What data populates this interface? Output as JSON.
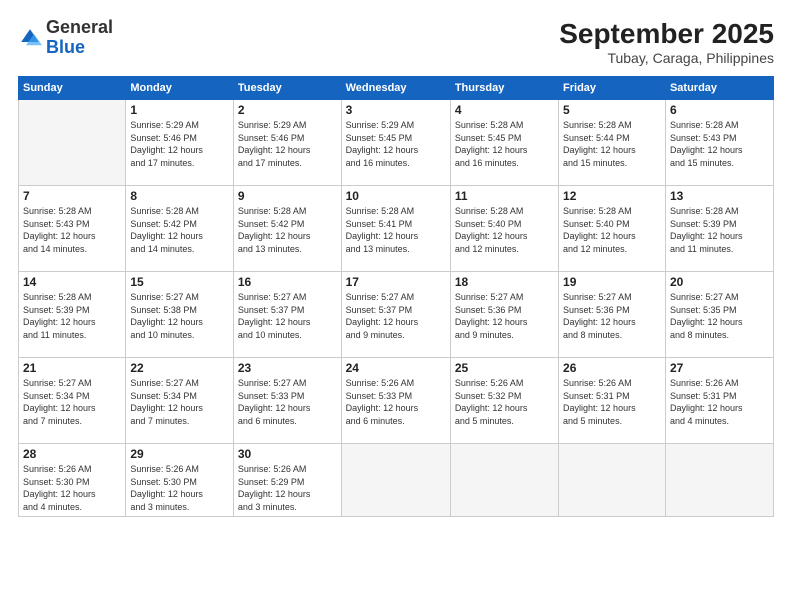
{
  "logo": {
    "general": "General",
    "blue": "Blue"
  },
  "header": {
    "month_year": "September 2025",
    "location": "Tubay, Caraga, Philippines"
  },
  "weekdays": [
    "Sunday",
    "Monday",
    "Tuesday",
    "Wednesday",
    "Thursday",
    "Friday",
    "Saturday"
  ],
  "weeks": [
    [
      {
        "day": "",
        "info": ""
      },
      {
        "day": "1",
        "info": "Sunrise: 5:29 AM\nSunset: 5:46 PM\nDaylight: 12 hours\nand 17 minutes."
      },
      {
        "day": "2",
        "info": "Sunrise: 5:29 AM\nSunset: 5:46 PM\nDaylight: 12 hours\nand 17 minutes."
      },
      {
        "day": "3",
        "info": "Sunrise: 5:29 AM\nSunset: 5:45 PM\nDaylight: 12 hours\nand 16 minutes."
      },
      {
        "day": "4",
        "info": "Sunrise: 5:28 AM\nSunset: 5:45 PM\nDaylight: 12 hours\nand 16 minutes."
      },
      {
        "day": "5",
        "info": "Sunrise: 5:28 AM\nSunset: 5:44 PM\nDaylight: 12 hours\nand 15 minutes."
      },
      {
        "day": "6",
        "info": "Sunrise: 5:28 AM\nSunset: 5:43 PM\nDaylight: 12 hours\nand 15 minutes."
      }
    ],
    [
      {
        "day": "7",
        "info": "Sunrise: 5:28 AM\nSunset: 5:43 PM\nDaylight: 12 hours\nand 14 minutes."
      },
      {
        "day": "8",
        "info": "Sunrise: 5:28 AM\nSunset: 5:42 PM\nDaylight: 12 hours\nand 14 minutes."
      },
      {
        "day": "9",
        "info": "Sunrise: 5:28 AM\nSunset: 5:42 PM\nDaylight: 12 hours\nand 13 minutes."
      },
      {
        "day": "10",
        "info": "Sunrise: 5:28 AM\nSunset: 5:41 PM\nDaylight: 12 hours\nand 13 minutes."
      },
      {
        "day": "11",
        "info": "Sunrise: 5:28 AM\nSunset: 5:40 PM\nDaylight: 12 hours\nand 12 minutes."
      },
      {
        "day": "12",
        "info": "Sunrise: 5:28 AM\nSunset: 5:40 PM\nDaylight: 12 hours\nand 12 minutes."
      },
      {
        "day": "13",
        "info": "Sunrise: 5:28 AM\nSunset: 5:39 PM\nDaylight: 12 hours\nand 11 minutes."
      }
    ],
    [
      {
        "day": "14",
        "info": "Sunrise: 5:28 AM\nSunset: 5:39 PM\nDaylight: 12 hours\nand 11 minutes."
      },
      {
        "day": "15",
        "info": "Sunrise: 5:27 AM\nSunset: 5:38 PM\nDaylight: 12 hours\nand 10 minutes."
      },
      {
        "day": "16",
        "info": "Sunrise: 5:27 AM\nSunset: 5:37 PM\nDaylight: 12 hours\nand 10 minutes."
      },
      {
        "day": "17",
        "info": "Sunrise: 5:27 AM\nSunset: 5:37 PM\nDaylight: 12 hours\nand 9 minutes."
      },
      {
        "day": "18",
        "info": "Sunrise: 5:27 AM\nSunset: 5:36 PM\nDaylight: 12 hours\nand 9 minutes."
      },
      {
        "day": "19",
        "info": "Sunrise: 5:27 AM\nSunset: 5:36 PM\nDaylight: 12 hours\nand 8 minutes."
      },
      {
        "day": "20",
        "info": "Sunrise: 5:27 AM\nSunset: 5:35 PM\nDaylight: 12 hours\nand 8 minutes."
      }
    ],
    [
      {
        "day": "21",
        "info": "Sunrise: 5:27 AM\nSunset: 5:34 PM\nDaylight: 12 hours\nand 7 minutes."
      },
      {
        "day": "22",
        "info": "Sunrise: 5:27 AM\nSunset: 5:34 PM\nDaylight: 12 hours\nand 7 minutes."
      },
      {
        "day": "23",
        "info": "Sunrise: 5:27 AM\nSunset: 5:33 PM\nDaylight: 12 hours\nand 6 minutes."
      },
      {
        "day": "24",
        "info": "Sunrise: 5:26 AM\nSunset: 5:33 PM\nDaylight: 12 hours\nand 6 minutes."
      },
      {
        "day": "25",
        "info": "Sunrise: 5:26 AM\nSunset: 5:32 PM\nDaylight: 12 hours\nand 5 minutes."
      },
      {
        "day": "26",
        "info": "Sunrise: 5:26 AM\nSunset: 5:31 PM\nDaylight: 12 hours\nand 5 minutes."
      },
      {
        "day": "27",
        "info": "Sunrise: 5:26 AM\nSunset: 5:31 PM\nDaylight: 12 hours\nand 4 minutes."
      }
    ],
    [
      {
        "day": "28",
        "info": "Sunrise: 5:26 AM\nSunset: 5:30 PM\nDaylight: 12 hours\nand 4 minutes."
      },
      {
        "day": "29",
        "info": "Sunrise: 5:26 AM\nSunset: 5:30 PM\nDaylight: 12 hours\nand 3 minutes."
      },
      {
        "day": "30",
        "info": "Sunrise: 5:26 AM\nSunset: 5:29 PM\nDaylight: 12 hours\nand 3 minutes."
      },
      {
        "day": "",
        "info": ""
      },
      {
        "day": "",
        "info": ""
      },
      {
        "day": "",
        "info": ""
      },
      {
        "day": "",
        "info": ""
      }
    ]
  ]
}
